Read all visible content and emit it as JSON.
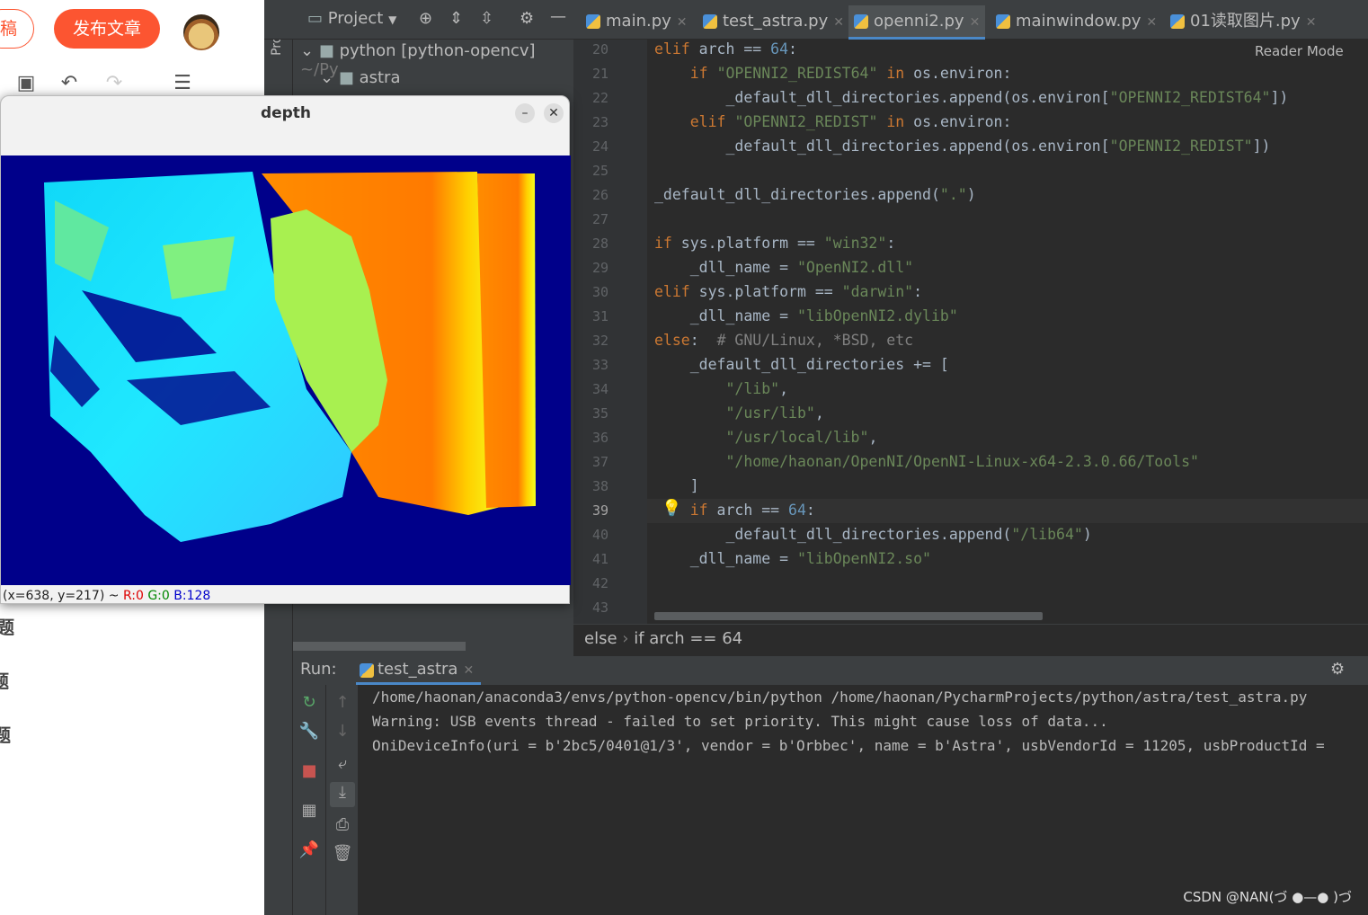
{
  "browser": {
    "draft_label": "稿",
    "publish_label": "发布文章",
    "side_items": [
      "题",
      "题",
      "题"
    ]
  },
  "ide": {
    "project_tab": "Project",
    "project_dropdown": "Project",
    "tree": [
      {
        "label": "python [python-opencv]",
        "suffix": "~/Py"
      },
      {
        "label": "astra"
      }
    ],
    "tabs": [
      "main.py",
      "test_astra.py",
      "openni2.py",
      "mainwindow.py",
      "01读取图片.py"
    ],
    "active_tab": "openni2.py",
    "reader_mode": "Reader Mode",
    "line_numbers": [
      "20",
      "21",
      "22",
      "23",
      "24",
      "25",
      "26",
      "27",
      "28",
      "29",
      "30",
      "31",
      "32",
      "33",
      "34",
      "35",
      "36",
      "37",
      "38",
      "39",
      "40",
      "41",
      "42",
      "43"
    ],
    "breadcrumb": [
      "else",
      "if arch == 64"
    ],
    "run_label": "Run:",
    "run_tab": "test_astra",
    "output": [
      "/home/haonan/anaconda3/envs/python-opencv/bin/python /home/haonan/PycharmProjects/python/astra/test_astra.py",
      "Warning: USB events thread - failed to set priority. This might cause loss of data...",
      "OniDeviceInfo(uri = b'2bc5/0401@1/3', vendor = b'Orbbec', name = b'Astra', usbVendorId = 11205, usbProductId ="
    ]
  },
  "depth_window": {
    "title": "depth",
    "status_prefix": "(x=638, y=217) ~ ",
    "r": "R:0",
    "g": "G:0",
    "b": "B:128"
  },
  "watermark": "CSDN @NAN(づ ●—● )づ"
}
